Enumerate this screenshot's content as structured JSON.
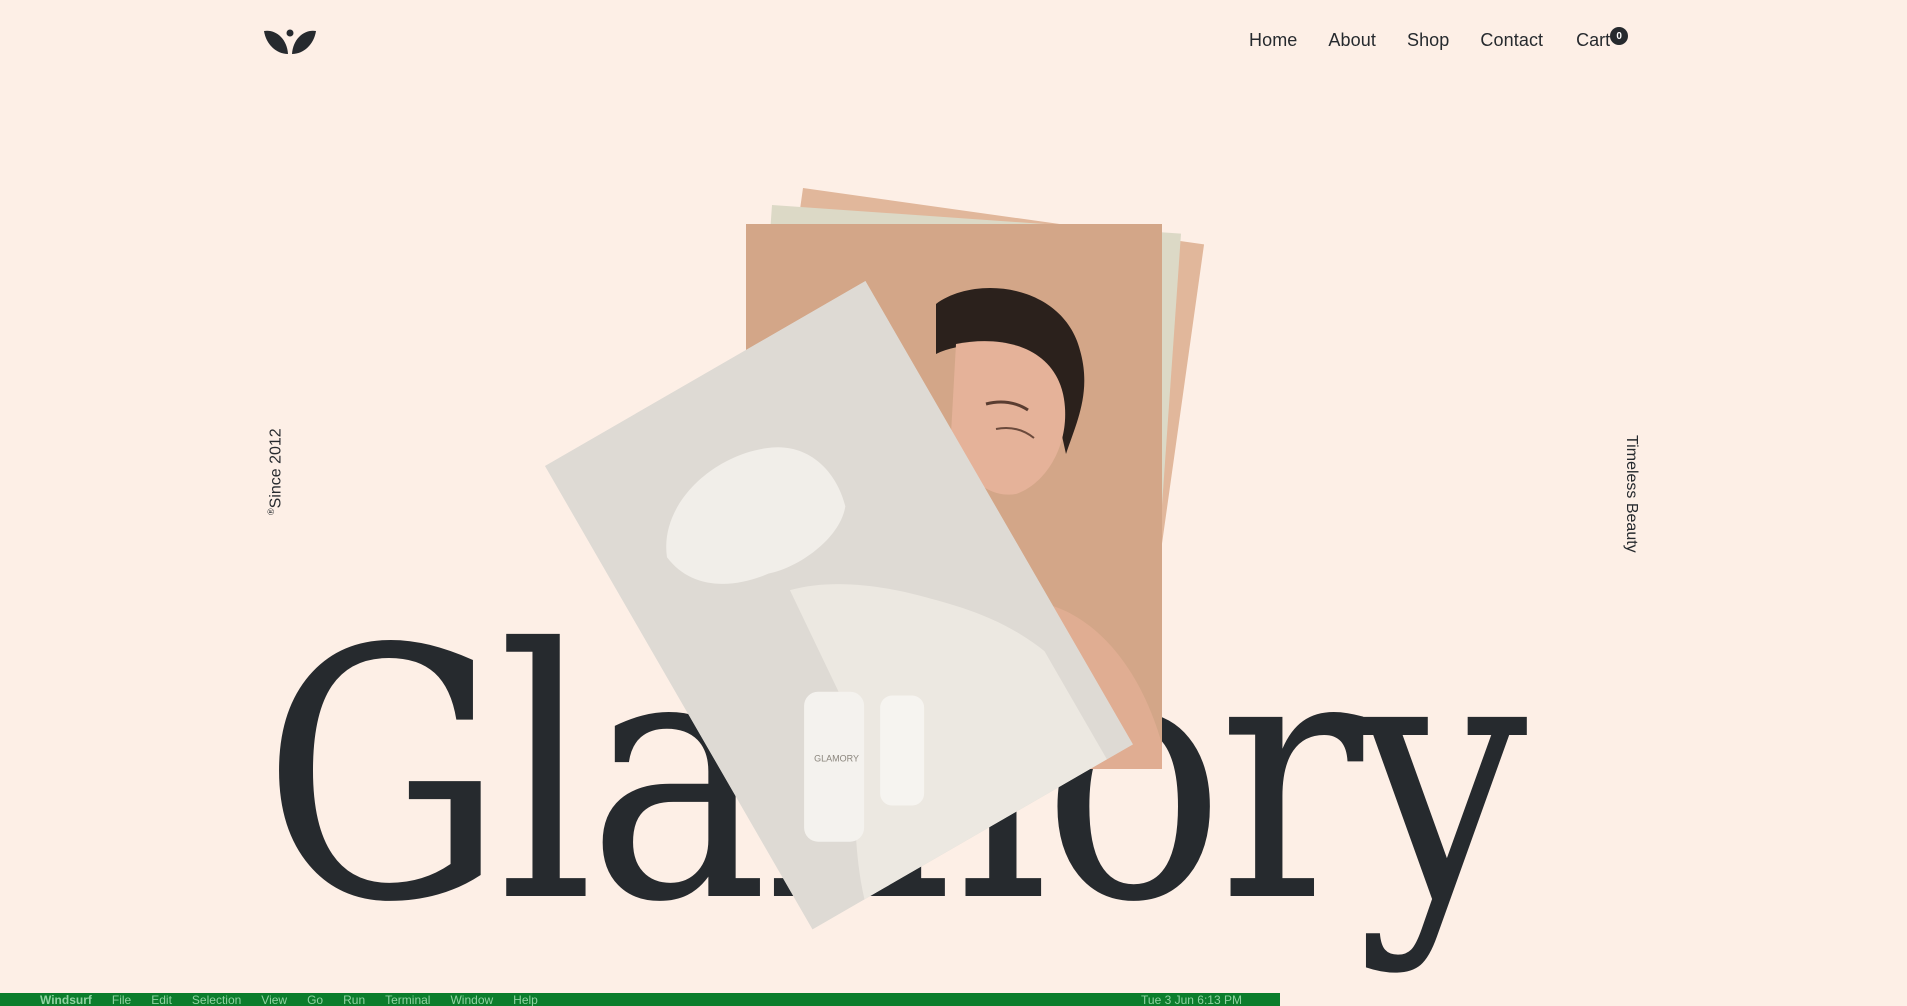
{
  "brand": {
    "logo_icon": "leaf-logo-icon"
  },
  "nav": {
    "items": [
      "Home",
      "About",
      "Shop",
      "Contact"
    ],
    "cart_label": "Cart",
    "cart_count": "0"
  },
  "side": {
    "left_mark": "®",
    "left_text": "Since 2012",
    "right_text": "Timeless Beauty"
  },
  "hero": {
    "word": "Glamory"
  },
  "product": {
    "bottle_label": "GLAMORY"
  },
  "menubar": {
    "app_name": "Windsurf",
    "menus": [
      "File",
      "Edit",
      "Selection",
      "View",
      "Go",
      "Run",
      "Terminal",
      "Window",
      "Help"
    ],
    "clock": "Tue 3 Jun  6:13 PM"
  },
  "colors": {
    "background": "#fdefe6",
    "ink": "#262a2e",
    "menubar": "#0b7d2c"
  }
}
